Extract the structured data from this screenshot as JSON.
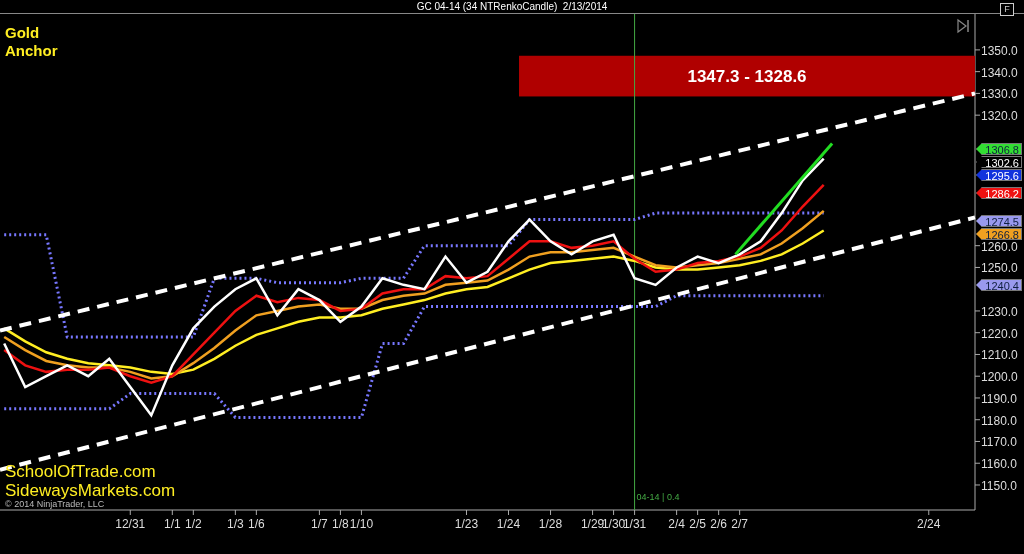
{
  "title": "GC 04-14 (34 NTRenkoCandle)  2/13/2014",
  "label_lines": [
    "Gold",
    "Anchor"
  ],
  "websites": [
    "SchoolOfTrade.com",
    "SidewaysMarkets.com"
  ],
  "copyright": "© 2014 NinjaTrader, LLC",
  "panel_button": "F",
  "price_tags": [
    {
      "text": "1306.8",
      "color": "#33dd33"
    },
    {
      "text": "1302.6",
      "color": "#000000"
    },
    {
      "text": "1295.6",
      "color": "#1133dd"
    },
    {
      "text": "1286.2",
      "color": "#ee1111"
    },
    {
      "text": "1274.5",
      "color": "#9999ee"
    },
    {
      "text": "1266.8",
      "color": "#f0a020"
    },
    {
      "text": "1240.4",
      "color": "#9999ee"
    }
  ],
  "zone_label": "1347.3 - 1328.6",
  "marker_label": "04-14 | 0.4",
  "chart_data": {
    "type": "line",
    "categories": [
      null,
      null,
      null,
      null,
      null,
      null,
      "12/31",
      null,
      "1/1",
      "1/2",
      null,
      "1/3",
      "1/6",
      null,
      null,
      "1/7",
      "1/8",
      "1/10",
      null,
      null,
      null,
      null,
      "1/23",
      null,
      "1/24",
      null,
      "1/28",
      null,
      "1/29",
      "1/30",
      "1/31",
      null,
      "2/4",
      "2/5",
      "2/6",
      "2/7",
      null,
      null,
      null,
      null,
      null,
      null,
      null,
      null,
      "2/24",
      null,
      null
    ],
    "ylim": [
      1138.5,
      1366.5
    ],
    "series": [
      {
        "color": "#7777ff",
        "line_style": "dotted",
        "values": [
          1265,
          1265,
          1265,
          1218,
          1218,
          1218,
          1218,
          1218,
          1218,
          1218,
          1245,
          1245,
          1245,
          1243,
          1243,
          1243,
          1243,
          1245,
          1245,
          1245,
          1260,
          1260,
          1260,
          1260,
          1260,
          1272,
          1272,
          1272,
          1272,
          1272,
          1272,
          1275,
          1275,
          1275,
          1275,
          1275,
          1275,
          1275,
          1275,
          1275,
          null,
          null,
          null,
          null,
          null,
          null,
          null
        ]
      },
      {
        "color": "#7777ff",
        "line_style": "dotted",
        "values": [
          1185,
          1185,
          1185,
          1185,
          1185,
          1185,
          1192,
          1192,
          1192,
          1192,
          1192,
          1181,
          1181,
          1181,
          1181,
          1181,
          1181,
          1181,
          1215,
          1215,
          1232,
          1232,
          1232,
          1232,
          1232,
          1232,
          1232,
          1232,
          1232,
          1232,
          1232,
          1232,
          1237,
          1237,
          1237,
          1237,
          1237,
          1237,
          1237,
          1237,
          null,
          null,
          null,
          null,
          null,
          null,
          null
        ]
      },
      {
        "color": "#ffee22",
        "values": [
          1222,
          1216,
          1211,
          1208,
          1206,
          1205,
          1204,
          1202,
          1201,
          1203,
          1208,
          1214,
          1219,
          1222,
          1225,
          1227,
          1227,
          1228,
          1231,
          1233,
          1235,
          1238,
          1240,
          1241,
          1245,
          1249,
          1252,
          1253,
          1254,
          1255,
          1253,
          1250,
          1249,
          1249,
          1250,
          1251,
          1253,
          1256,
          1261,
          1267,
          null,
          null,
          null,
          null,
          null,
          null,
          null
        ]
      },
      {
        "color": "#f0a020",
        "values": [
          1218,
          1212,
          1207,
          1205,
          1204,
          1204,
          1202,
          1199,
          1200,
          1206,
          1213,
          1221,
          1228,
          1230,
          1232,
          1233,
          1231,
          1231,
          1235,
          1237,
          1238,
          1242,
          1243,
          1244,
          1249,
          1255,
          1257,
          1257,
          1258,
          1259,
          1255,
          1251,
          1250,
          1251,
          1252,
          1254,
          1256,
          1261,
          1268,
          1276,
          null,
          null,
          null,
          null,
          null,
          null,
          null
        ]
      },
      {
        "color": "#ee1111",
        "values": [
          1212,
          1205,
          1202,
          1203,
          1203,
          1204,
          1200,
          1197,
          1200,
          1210,
          1220,
          1230,
          1237,
          1234,
          1236,
          1235,
          1230,
          1231,
          1238,
          1240,
          1240,
          1246,
          1245,
          1246,
          1254,
          1262,
          1262,
          1259,
          1260,
          1262,
          1254,
          1248,
          1249,
          1252,
          1253,
          1255,
          1259,
          1267,
          1278,
          1288,
          null,
          null,
          null,
          null,
          null,
          null,
          null
        ]
      },
      {
        "color": "#ffffff",
        "values": [
          1215,
          1195,
          1200,
          1205,
          1200,
          1208,
          1195,
          1182,
          1205,
          1222,
          1232,
          1240,
          1245,
          1228,
          1240,
          1235,
          1225,
          1232,
          1245,
          1242,
          1240,
          1255,
          1243,
          1248,
          1262,
          1272,
          1262,
          1256,
          1262,
          1265,
          1245,
          1242,
          1250,
          1255,
          1252,
          1256,
          1262,
          1275,
          1290,
          1300,
          null,
          null,
          null,
          null,
          null,
          null,
          null
        ]
      }
    ],
    "yticks": [
      {
        "value": 1150,
        "label": "1150.0"
      },
      {
        "value": 1160,
        "label": "1160.0"
      },
      {
        "value": 1170,
        "label": "1170.0"
      },
      {
        "value": 1180,
        "label": "1180.0"
      },
      {
        "value": 1190,
        "label": "1190.0"
      },
      {
        "value": 1200,
        "label": "1200.0"
      },
      {
        "value": 1210,
        "label": "1210.0"
      },
      {
        "value": 1220,
        "label": "1220.0"
      },
      {
        "value": 1230,
        "label": "1230.0"
      },
      {
        "value": 1250,
        "label": "1250.0"
      },
      {
        "value": 1260,
        "label": "1260.0"
      },
      {
        "value": 1320,
        "label": "1320.0"
      },
      {
        "value": 1330,
        "label": "1330.0"
      },
      {
        "value": 1340,
        "label": "1340.0"
      },
      {
        "value": 1350,
        "label": "1350.0"
      }
    ]
  }
}
